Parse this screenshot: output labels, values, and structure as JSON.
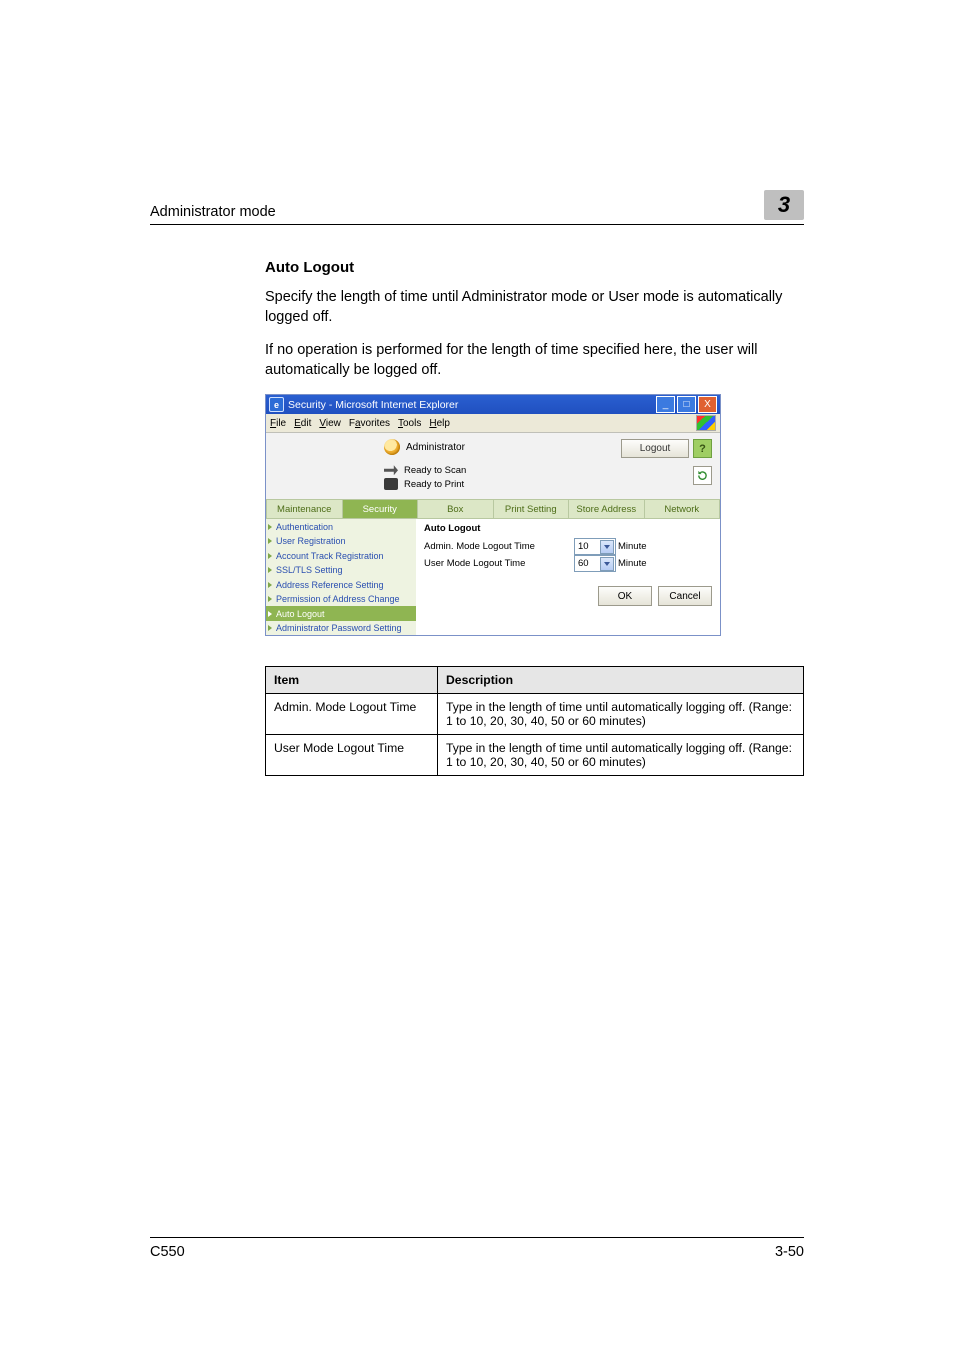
{
  "running_head": {
    "left": "Administrator mode",
    "badge": "3"
  },
  "section": {
    "title": "Auto Logout",
    "p1": "Specify the length of time until Administrator mode or User mode is automatically logged off.",
    "p2": "If no operation is performed for the length of time specified here, the user will automatically be logged off."
  },
  "shot": {
    "title": "Security - Microsoft Internet Explorer",
    "window_ctrl": {
      "min": "_",
      "max": "□",
      "close": "X"
    },
    "menu": [
      "File",
      "Edit",
      "View",
      "Favorites",
      "Tools",
      "Help"
    ],
    "banner": {
      "role": "Administrator",
      "scan": "Ready to Scan",
      "print": "Ready to Print",
      "logout": "Logout",
      "help": "?",
      "refresh_title": "refresh-icon"
    },
    "tabs": [
      "Maintenance",
      "Security",
      "Box",
      "Print Setting",
      "Store Address",
      "Network"
    ],
    "active_tab_index": 1,
    "sidenav": [
      "Authentication",
      "User Registration",
      "Account Track Registration",
      "SSL/TLS Setting",
      "Address Reference Setting",
      "Permission of Address Change",
      "Auto Logout",
      "Administrator Password Setting"
    ],
    "active_side_index": 6,
    "main": {
      "title": "Auto Logout",
      "rows": [
        {
          "label": "Admin. Mode Logout Time",
          "value": "10",
          "unit": "Minute"
        },
        {
          "label": "User Mode Logout Time",
          "value": "60",
          "unit": "Minute"
        }
      ],
      "buttons": {
        "ok": "OK",
        "cancel": "Cancel"
      }
    }
  },
  "table": {
    "head": [
      "Item",
      "Description"
    ],
    "rows": [
      {
        "k": "Admin. Mode Logout Time",
        "v": "Type in the length of time until automatically logging off. (Range: 1 to 10, 20, 30, 40, 50 or 60 minutes)"
      },
      {
        "k": "User Mode Logout Time",
        "v": "Type in the length of time until automatically logging off. (Range: 1 to 10, 20, 30, 40, 50 or 60 minutes)"
      }
    ]
  },
  "footer": {
    "left": "C550",
    "right": "3-50"
  }
}
